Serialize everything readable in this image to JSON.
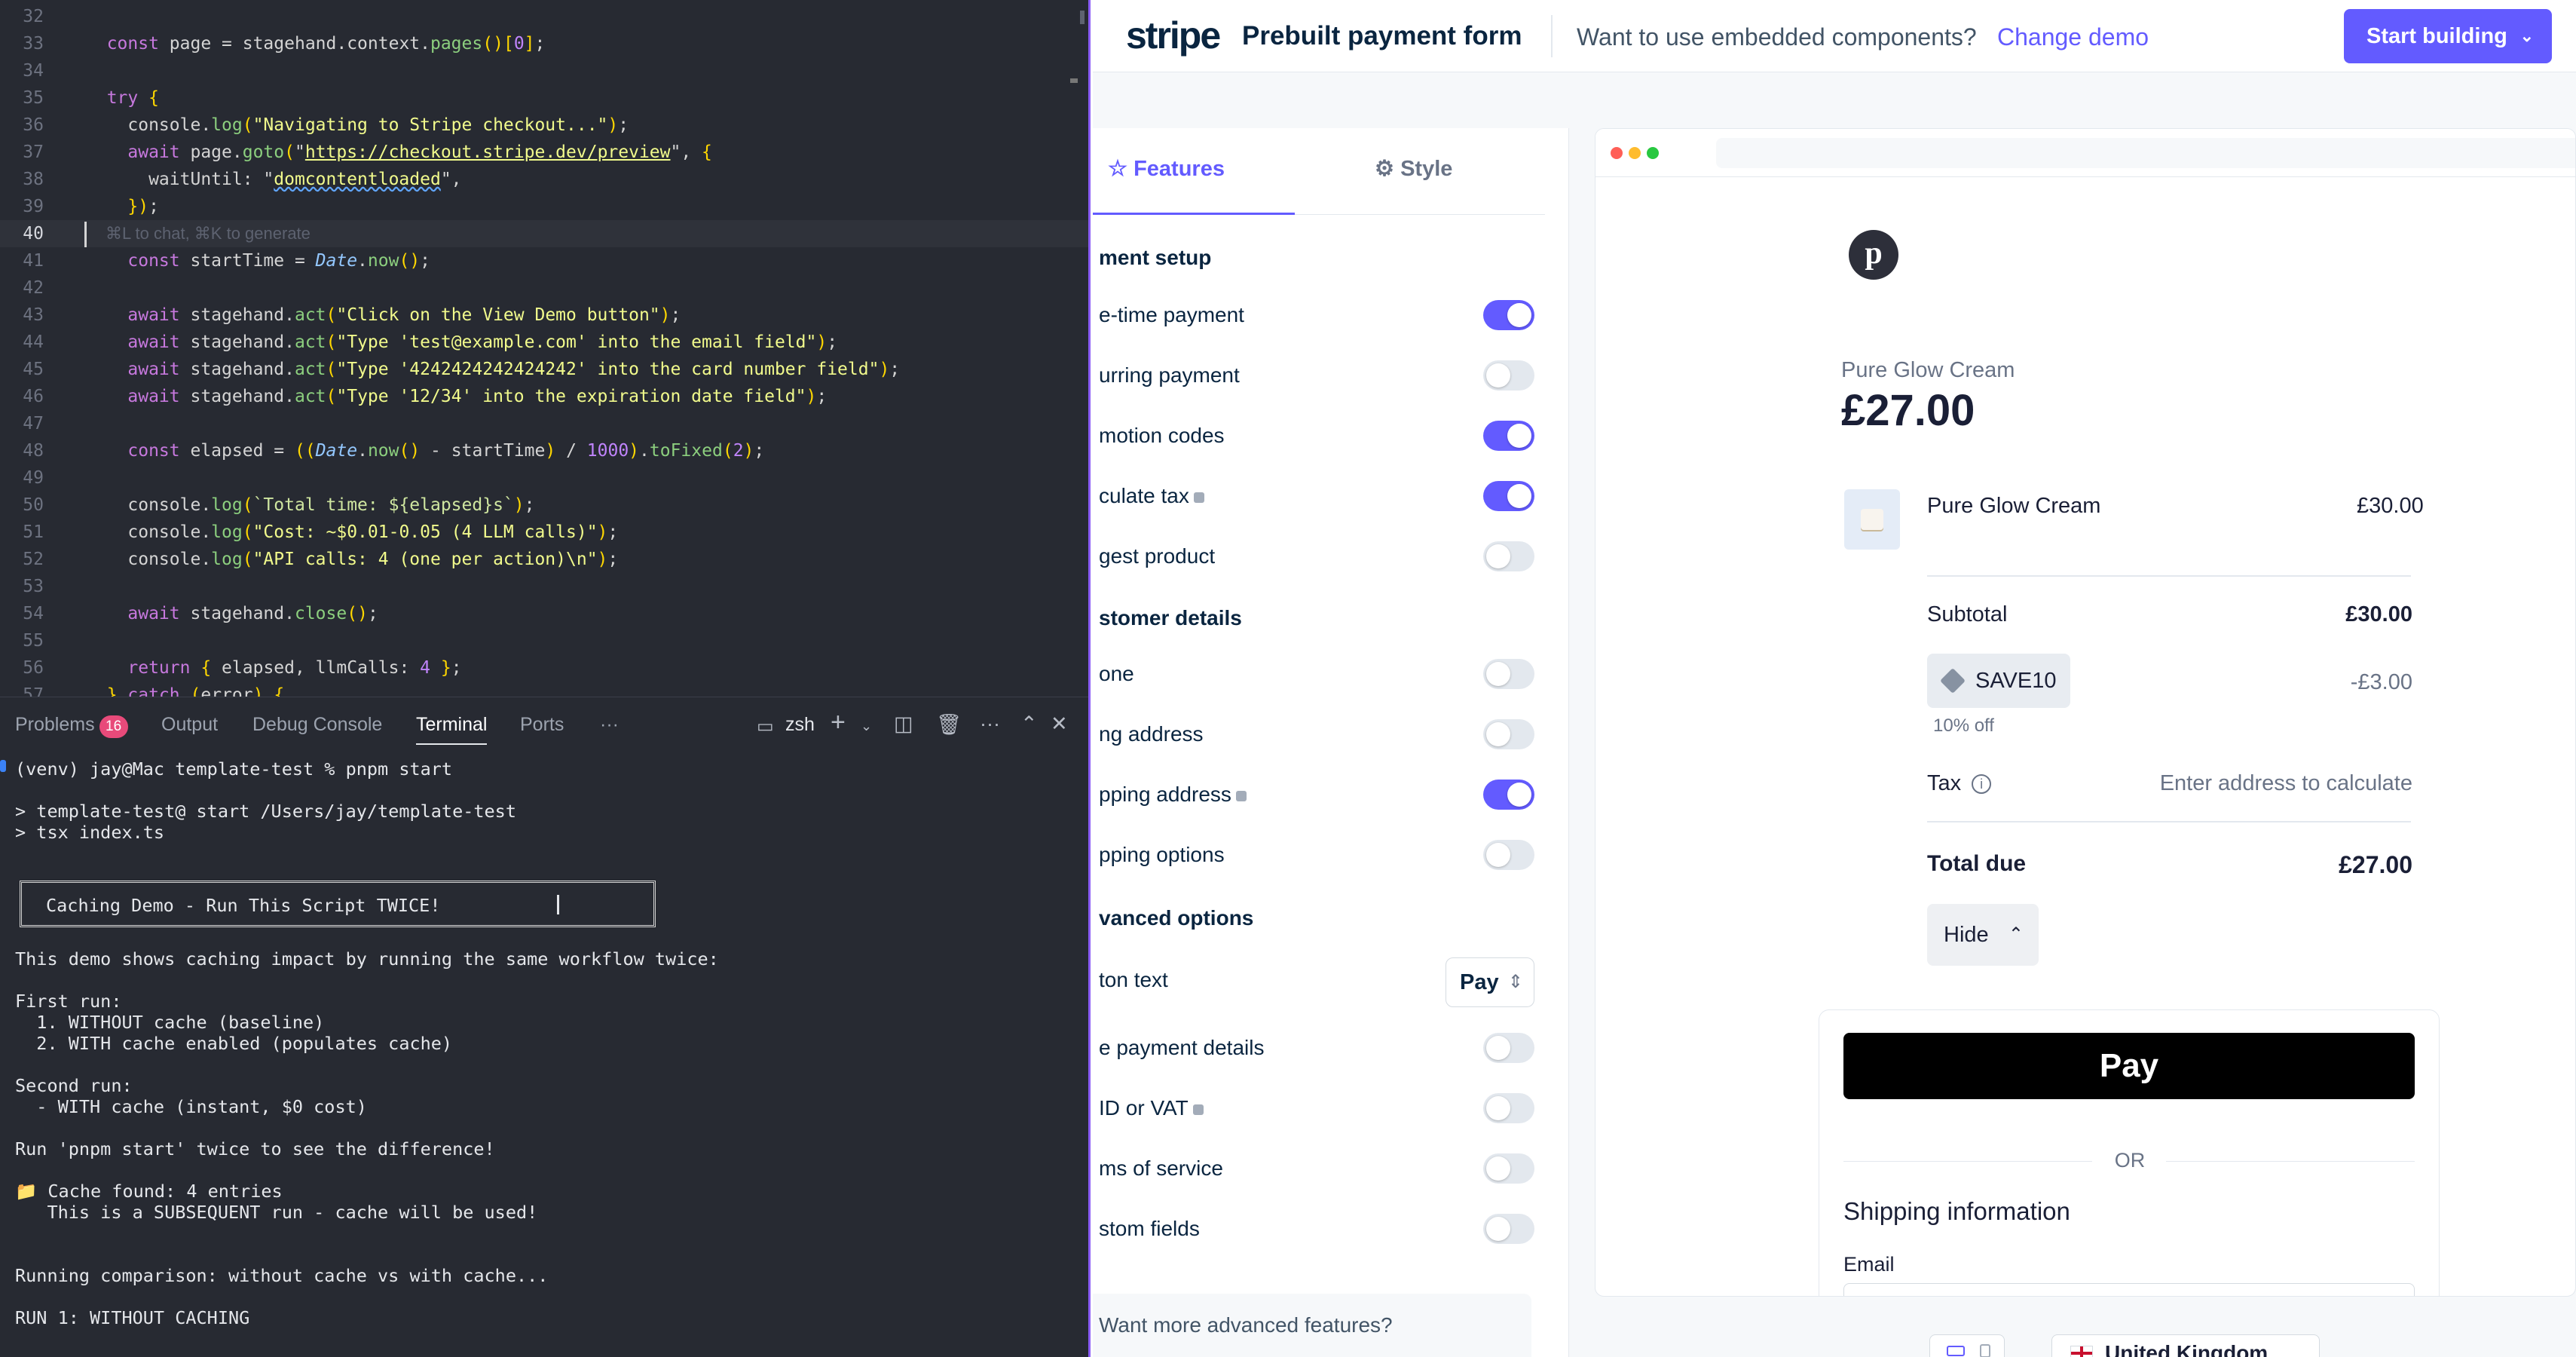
{
  "editor": {
    "lines": [
      {
        "num": "32",
        "text": ""
      },
      {
        "num": "33",
        "text": "  const page = stagehand.context.pages()[0];"
      },
      {
        "num": "34",
        "text": ""
      },
      {
        "num": "35",
        "text": "  try {"
      },
      {
        "num": "36",
        "text": "    console.log(\"Navigating to Stripe checkout...\");"
      },
      {
        "num": "37",
        "text": "    await page.goto(\"https://checkout.stripe.dev/preview\", {"
      },
      {
        "num": "38",
        "text": "      waitUntil: \"domcontentloaded\","
      },
      {
        "num": "39",
        "text": "    });"
      },
      {
        "num": "40",
        "text": ""
      },
      {
        "num": "41",
        "text": "    const startTime = Date.now();"
      },
      {
        "num": "42",
        "text": ""
      },
      {
        "num": "43",
        "text": "    await stagehand.act(\"Click on the View Demo button\");"
      },
      {
        "num": "44",
        "text": "    await stagehand.act(\"Type 'test@example.com' into the email field\");"
      },
      {
        "num": "45",
        "text": "    await stagehand.act(\"Type '4242424242424242' into the card number field\");"
      },
      {
        "num": "46",
        "text": "    await stagehand.act(\"Type '12/34' into the expiration date field\");"
      },
      {
        "num": "47",
        "text": ""
      },
      {
        "num": "48",
        "text": "    const elapsed = ((Date.now() - startTime) / 1000).toFixed(2);"
      },
      {
        "num": "49",
        "text": ""
      },
      {
        "num": "50",
        "text": "    console.log(`Total time: ${elapsed}s`);"
      },
      {
        "num": "51",
        "text": "    console.log(\"Cost: ~$0.01-0.05 (4 LLM calls)\");"
      },
      {
        "num": "52",
        "text": "    console.log(\"API calls: 4 (one per action)\\n\");"
      },
      {
        "num": "53",
        "text": ""
      },
      {
        "num": "54",
        "text": "    await stagehand.close();"
      },
      {
        "num": "55",
        "text": ""
      },
      {
        "num": "56",
        "text": "    return { elapsed, llmCalls: 4 };"
      },
      {
        "num": "57",
        "text": "  } catch (error) {"
      }
    ],
    "inline_hint": "⌘L to chat, ⌘K to generate"
  },
  "panel": {
    "tabs": [
      "Problems",
      "Output",
      "Debug Console",
      "Terminal",
      "Ports",
      "···"
    ],
    "problems_count": "16",
    "shell": "zsh"
  },
  "terminal": {
    "lines": [
      "(venv) jay@Mac template-test % pnpm start",
      "",
      "> template-test@ start /Users/jay/template-test",
      "> tsx index.ts",
      "",
      "",
      "",
      "",
      "",
      "This demo shows caching impact by running the same workflow twice:",
      "",
      "First run:",
      "  1. WITHOUT cache (baseline)",
      "  2. WITH cache enabled (populates cache)",
      "",
      "Second run:",
      "  - WITH cache (instant, $0 cost)",
      "",
      "Run 'pnpm start' twice to see the difference!",
      "",
      "📁 Cache found: 4 entries",
      "   This is a SUBSEQUENT run - cache will be used!",
      "",
      "",
      "Running comparison: without cache vs with cache...",
      "",
      "RUN 1: WITHOUT CACHING"
    ],
    "box_text": "Caching Demo - Run This Script TWICE!"
  },
  "stripe": {
    "logo": "stripe",
    "title": "Prebuilt payment form",
    "question": "Want to use embedded components?",
    "change_demo": "Change demo",
    "start_building": "Start building",
    "tabs": {
      "features": "Features",
      "style": "Style"
    },
    "sections": {
      "payment_setup": "ment setup",
      "customer_details": "stomer details",
      "advanced_options": "vanced options"
    },
    "payment_rows": [
      {
        "label": "e-time payment",
        "on": true
      },
      {
        "label": "urring payment",
        "on": false
      },
      {
        "label": "motion codes",
        "on": true
      },
      {
        "label": "culate tax",
        "on": true,
        "info": true
      },
      {
        "label": "gest product",
        "on": false
      }
    ],
    "customer_rows": [
      {
        "label": "one",
        "on": false
      },
      {
        "label": "ng address",
        "on": false
      },
      {
        "label": "pping address",
        "on": true,
        "info": true
      },
      {
        "label": "pping options",
        "on": false
      }
    ],
    "advanced_rows": [
      {
        "label": "ton text",
        "select": "Pay"
      },
      {
        "label": "e payment details",
        "on": false
      },
      {
        "label": "ID or VAT",
        "on": false,
        "info": true
      },
      {
        "label": "ms of service",
        "on": false
      },
      {
        "label": "stom fields",
        "on": false
      }
    ],
    "advanced_card": "Want more advanced features?",
    "checkout": {
      "merchant_initial": "p",
      "product_name": "Pure Glow Cream",
      "price": "£27.00",
      "line_item": "Pure Glow Cream",
      "line_amount": "£30.00",
      "subtotal_label": "Subtotal",
      "subtotal": "£30.00",
      "promo_code": "SAVE10",
      "promo_sub": "10% off",
      "discount": "-£3.00",
      "tax_label": "Tax",
      "tax_value": "Enter address to calculate",
      "total_label": "Total due",
      "total": "£27.00",
      "hide": "Hide",
      "apple_pay": " Pay",
      "or": "OR",
      "shipping": "Shipping information",
      "email": "Email"
    },
    "country": "United Kingdom",
    "colors": {
      "accent": "#635bff",
      "navy": "#0a2540"
    }
  }
}
